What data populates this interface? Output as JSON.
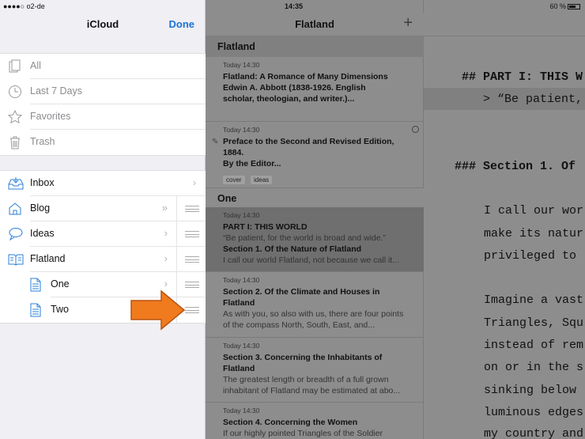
{
  "status": {
    "carrier": "●●●●○ o2-de",
    "time": "14:35",
    "battery": "60 %"
  },
  "sidebar": {
    "title": "iCloud",
    "done_label": "Done",
    "smart_items": [
      {
        "label": "All",
        "icon": "notes-stack-icon"
      },
      {
        "label": "Last 7 Days",
        "icon": "clock-icon"
      },
      {
        "label": "Favorites",
        "icon": "star-icon"
      },
      {
        "label": "Trash",
        "icon": "trash-icon"
      }
    ],
    "folders": [
      {
        "label": "Inbox",
        "icon": "inbox-icon"
      },
      {
        "label": "Blog",
        "icon": "house-icon"
      },
      {
        "label": "Ideas",
        "icon": "speech-bubble-icon"
      },
      {
        "label": "Flatland",
        "icon": "book-icon"
      },
      {
        "label": "One",
        "icon": "document-icon"
      },
      {
        "label": "Two",
        "icon": "document-icon"
      }
    ]
  },
  "note_list": {
    "title": "Flatland",
    "sections": [
      "Flatland",
      "One"
    ],
    "notes": [
      {
        "date": "Today 14:30",
        "title": "Flatland: A Romance of Many Dimensions",
        "lines": [
          "Edwin A. Abbott (1838-1926. English",
          "scholar, theologian, and writer.)..."
        ]
      },
      {
        "date": "Today 14:30",
        "title": "Preface to the Second and Revised Edition, 1884.",
        "lines": [
          "By the Editor..."
        ],
        "tags": [
          "cover",
          "ideas"
        ]
      },
      {
        "date": "Today 14:30",
        "title": "PART I: THIS WORLD",
        "quote": "“Be patient, for the world is broad and wide.”",
        "subtitle": "Section 1. Of the Nature of Flatland",
        "excerpt": "I call our world Flatland, not because we call it..."
      },
      {
        "date": "Today 14:30",
        "title": "Section 2. Of the Climate and Houses in Flatland",
        "excerpt": "As with you, so also with us, there are four points of the compass North, South, East, and..."
      },
      {
        "date": "Today 14:30",
        "title": "Section 3. Concerning the Inhabitants of Flatland",
        "excerpt": "The greatest length or breadth of a full grown inhabitant of Flatland may be estimated at abo..."
      },
      {
        "date": "Today 14:30",
        "title": "Section 4. Concerning the Women",
        "excerpt": "If our highly pointed Triangles of the Soldier"
      }
    ]
  },
  "editor": {
    "lines": [
      "## PART I: THIS W",
      "   > “Be patient,",
      "### Section 1. Of",
      "    I call our wor",
      "    make its natur",
      "    privileged to",
      "    Imagine a vast",
      "    Triangles, Squ",
      "    instead of rem",
      "    on or in the s",
      "    sinking below",
      "    luminous edges",
      "    my country and"
    ]
  },
  "colors": {
    "accent": "#1a73d9",
    "arrow": "#f07a1e",
    "folder_icon": "#2b7fd8"
  }
}
